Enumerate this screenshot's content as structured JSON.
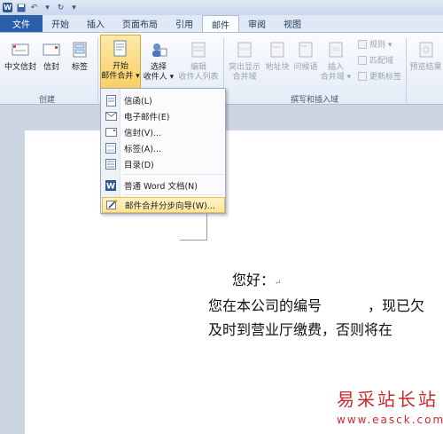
{
  "tabs": [
    "文件",
    "开始",
    "插入",
    "页面布局",
    "引用",
    "邮件",
    "审阅",
    "视图"
  ],
  "ribbon": {
    "create": {
      "chinese_envelope": "中文信封",
      "envelope": "信封",
      "labels": "标签",
      "group_label": "创建"
    },
    "start_merge": {
      "start": "开始",
      "mail_merge": "邮件合并 ▾",
      "select": "选择",
      "recipients": "收件人 ▾",
      "edit": "编辑",
      "recipient_list": "收件人列表"
    },
    "write_insert": {
      "highlight": "突出显示",
      "merge_fields": "合并域",
      "address_block": "地址块",
      "greeting": "问候语",
      "insert": "插入",
      "merge_field": "合并域 ▾",
      "rules": "规则 ▾",
      "match_fields": "匹配域",
      "update_labels": "更新标签",
      "group_label": "撰写和插入域"
    },
    "preview": "预览结果"
  },
  "menu": {
    "items": [
      {
        "label": "信函(L)",
        "icon": "letter-icon"
      },
      {
        "label": "电子邮件(E)",
        "icon": "email-icon"
      },
      {
        "label": "信封(V)...",
        "icon": "envelope-icon"
      },
      {
        "label": "标签(A)...",
        "icon": "label-icon"
      },
      {
        "label": "目录(D)",
        "icon": "directory-icon"
      },
      {
        "label": "普通 Word 文档(N)",
        "icon": "word-doc-icon"
      },
      {
        "label": "邮件合并分步向导(W)...",
        "icon": "wizard-icon"
      }
    ]
  },
  "document": {
    "line1": "您好：",
    "line2a": "您在本公司的编号",
    "line2b": "，现已欠",
    "line3": "及时到营业厅缴费，否则将在"
  },
  "watermark": {
    "title": "易采站长站",
    "url": "www.easck.com"
  },
  "colors": {
    "accent": "#2a5ea8",
    "watermark": "#c9282d"
  }
}
